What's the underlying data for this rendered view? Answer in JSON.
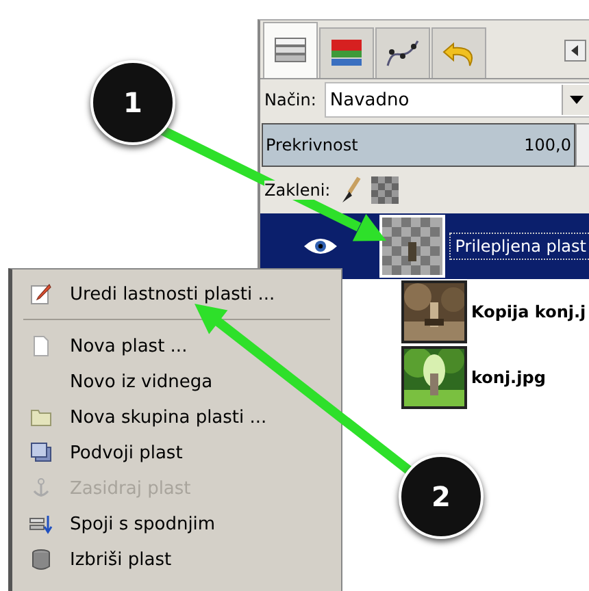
{
  "panel": {
    "tabs": [
      {
        "kind": "layers",
        "selected": true
      },
      {
        "kind": "channels",
        "selected": false
      },
      {
        "kind": "paths",
        "selected": false
      },
      {
        "kind": "undo",
        "selected": false
      }
    ],
    "mode": {
      "label": "Način:",
      "value": "Navadno"
    },
    "opacity": {
      "label": "Prekrivnost",
      "value": "100,0",
      "level": 1.0
    },
    "lock_label": "Zakleni:",
    "layers": [
      {
        "name": "Prilepljena plast",
        "selected": true,
        "visible": true,
        "kind": "transparent"
      },
      {
        "name": "Kopija konj.j",
        "selected": false,
        "visible": false,
        "kind": "sepia"
      },
      {
        "name": "konj.jpg",
        "selected": false,
        "visible": false,
        "kind": "green"
      }
    ]
  },
  "menu": {
    "items": [
      {
        "label": "Uredi lastnosti plasti ...",
        "kind": "edit",
        "disabled": false
      },
      {
        "kind": "separator"
      },
      {
        "label": "Nova plast ...",
        "kind": "new",
        "disabled": false
      },
      {
        "label": "Novo iz vidnega",
        "kind": "none",
        "disabled": false
      },
      {
        "label": "Nova skupina plasti ...",
        "kind": "folder",
        "disabled": false
      },
      {
        "label": "Podvoji plast",
        "kind": "duplicate",
        "disabled": false
      },
      {
        "label": "Zasidraj plast",
        "kind": "anchor",
        "disabled": true
      },
      {
        "label": "Spoji s spodnjim",
        "kind": "merge",
        "disabled": false
      },
      {
        "label": "Izbriši plast",
        "kind": "delete",
        "disabled": false
      }
    ]
  },
  "callouts": [
    {
      "number": "1"
    },
    {
      "number": "2"
    }
  ]
}
